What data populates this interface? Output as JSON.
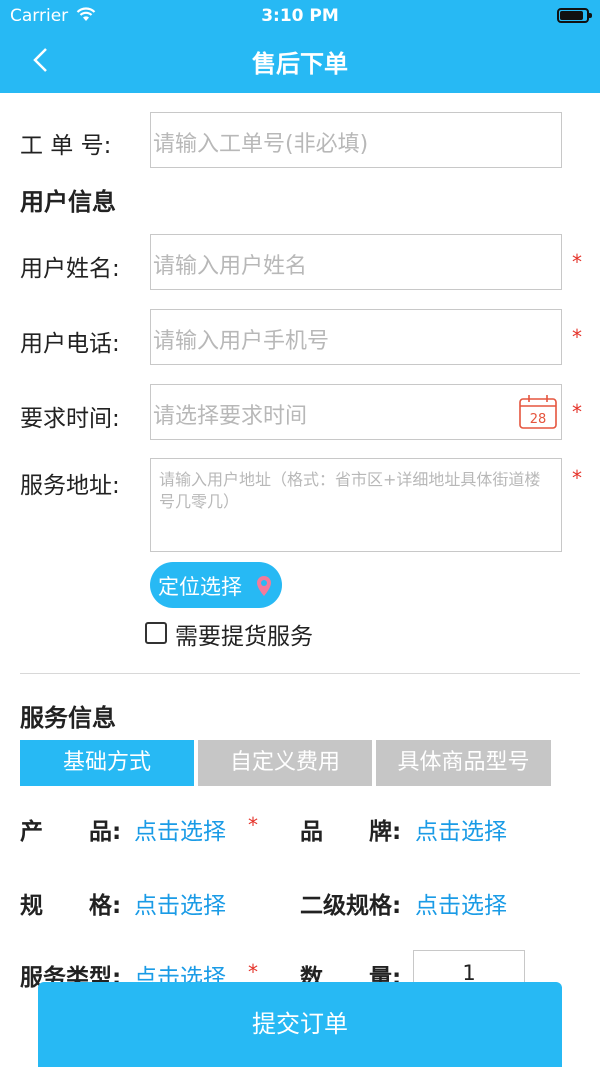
{
  "status_bar": {
    "carrier": "Carrier",
    "time": "3:10 PM",
    "battery_level": 0.9
  },
  "nav": {
    "title": "售后下单"
  },
  "order_no": {
    "label": "工 单 号:",
    "placeholder": "请输入工单号(非必填)"
  },
  "user_section": {
    "title": "用户信息"
  },
  "user_name": {
    "label": "用户姓名:",
    "placeholder": "请输入用户姓名",
    "required": "*"
  },
  "user_phone": {
    "label": "用户电话:",
    "placeholder": "请输入用户手机号",
    "required": "*"
  },
  "req_time": {
    "label": "要求时间:",
    "placeholder": "请选择要求时间",
    "required": "*",
    "calendar_day": "28"
  },
  "address": {
    "label": "服务地址:",
    "placeholder": "请输入用户地址（格式：省市区+详细地址具体街道楼号几零几）",
    "required": "*"
  },
  "locate": {
    "label": "定位选择"
  },
  "pickup": {
    "label": "需要提货服务",
    "checked": false
  },
  "service_section": {
    "title": "服务信息"
  },
  "tabs": [
    {
      "label": "基础方式",
      "active": true
    },
    {
      "label": "自定义费用",
      "active": false
    },
    {
      "label": "具体商品型号",
      "active": false
    }
  ],
  "fields": {
    "product": {
      "label": "产　　品:",
      "value": "点击选择",
      "required": "*"
    },
    "brand": {
      "label": "品　　牌:",
      "value": "点击选择"
    },
    "spec": {
      "label": "规　　格:",
      "value": "点击选择"
    },
    "sub_spec": {
      "label": "二级规格:",
      "value": "点击选择"
    },
    "service_type": {
      "label": "服务类型:",
      "value": "点击选择",
      "required": "*"
    },
    "quantity": {
      "label": "数　　量:",
      "value": "1"
    }
  },
  "submit": {
    "label": "提交订单"
  },
  "colors": {
    "primary": "#27b9f4",
    "link": "#1a9be6",
    "required": "#e5332a",
    "tab_inactive": "#c6c6c6"
  },
  "icons": {
    "back": "chevron-left-icon",
    "calendar": "calendar-icon",
    "location": "location-pin-icon",
    "wifi": "wifi-icon",
    "battery": "battery-icon"
  }
}
